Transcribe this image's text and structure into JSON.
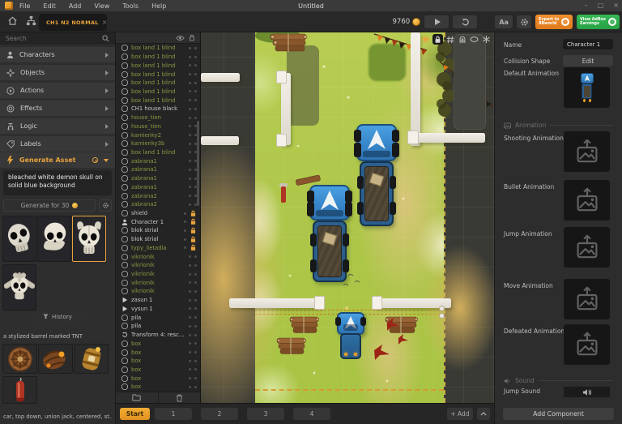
{
  "window": {
    "title": "Untitled",
    "menus": [
      "File",
      "Edit",
      "Add",
      "View",
      "Tools",
      "Help"
    ],
    "controls": {
      "min": "–",
      "max": "□",
      "close": "×"
    }
  },
  "toolbar": {
    "tab": "CH1 N2 NORMAL",
    "tab_close": "×",
    "coins": "9760",
    "font_button": "Aa",
    "export_line1": "Export to",
    "export_line2": "8Bworld",
    "earnings_line1": "View AdBox",
    "earnings_line2": "Earnings"
  },
  "sidebar": {
    "search_placeholder": "Search",
    "sections": [
      {
        "label": "Characters"
      },
      {
        "label": "Objects"
      },
      {
        "label": "Actions"
      },
      {
        "label": "Effects"
      },
      {
        "label": "Logic"
      },
      {
        "label": "Labels"
      }
    ],
    "generate_section": "Generate Asset",
    "prompt_text": "bleached white demon skull on solid blue background",
    "generate_button": "Generate for 30",
    "history_button": "History",
    "tnt_prompt": "a stylized barrel marked TNT",
    "car_prompt": "car, top down, union jack, centered, st..."
  },
  "layers": {
    "items": [
      {
        "name": "box land 1 blind",
        "cls": "g",
        "icon": "obj"
      },
      {
        "name": "box land 1 blind",
        "cls": "g",
        "icon": "obj"
      },
      {
        "name": "box land 1 blind",
        "cls": "g",
        "icon": "obj"
      },
      {
        "name": "box land 1 blind",
        "cls": "g",
        "icon": "obj"
      },
      {
        "name": "box land 1 blind",
        "cls": "g",
        "icon": "obj"
      },
      {
        "name": "box land 1 blind",
        "cls": "g",
        "icon": "obj"
      },
      {
        "name": "box land 1 blind",
        "cls": "g",
        "icon": "obj"
      },
      {
        "name": "CH1 house black",
        "cls": "w",
        "icon": "obj"
      },
      {
        "name": "house_tien",
        "cls": "g",
        "icon": "obj"
      },
      {
        "name": "house_tien",
        "cls": "g",
        "icon": "obj"
      },
      {
        "name": "kamienky2",
        "cls": "g",
        "icon": "obj"
      },
      {
        "name": "kamienky3b",
        "cls": "g",
        "icon": "obj"
      },
      {
        "name": "box land 1 blind",
        "cls": "g",
        "icon": "obj"
      },
      {
        "name": "zabrana1",
        "cls": "g",
        "icon": "obj"
      },
      {
        "name": "zabrana1",
        "cls": "g",
        "icon": "obj"
      },
      {
        "name": "zabrana1",
        "cls": "g",
        "icon": "obj"
      },
      {
        "name": "zabrana1",
        "cls": "g",
        "icon": "obj"
      },
      {
        "name": "zabrana2",
        "cls": "g",
        "icon": "obj"
      },
      {
        "name": "zabrana2",
        "cls": "g",
        "icon": "obj"
      },
      {
        "name": "shield",
        "cls": "w",
        "icon": "obj",
        "lock": true
      },
      {
        "name": "Character 1",
        "cls": "w",
        "icon": "person",
        "lock": true
      },
      {
        "name": "blok strial",
        "cls": "w",
        "icon": "obj",
        "lock": true
      },
      {
        "name": "blok strial",
        "cls": "w",
        "icon": "obj",
        "lock": true
      },
      {
        "name": "typy_lietadla",
        "cls": "g",
        "icon": "obj",
        "lock": true
      },
      {
        "name": "vikrionik",
        "cls": "g",
        "icon": "obj"
      },
      {
        "name": "vikrionik",
        "cls": "g",
        "icon": "obj"
      },
      {
        "name": "vikrionik",
        "cls": "g",
        "icon": "obj"
      },
      {
        "name": "vikrionik",
        "cls": "g",
        "icon": "obj"
      },
      {
        "name": "vikrionik",
        "cls": "g",
        "icon": "obj"
      },
      {
        "name": "zasun 1",
        "cls": "w",
        "icon": "tri"
      },
      {
        "name": "vysun 1",
        "cls": "w",
        "icon": "tri"
      },
      {
        "name": "pila",
        "cls": "w",
        "icon": "obj"
      },
      {
        "name": "pila",
        "cls": "w",
        "icon": "obj"
      },
      {
        "name": "Transform 4: rescue...",
        "cls": "w",
        "icon": "ref"
      },
      {
        "name": "box",
        "cls": "g",
        "icon": "obj"
      },
      {
        "name": "box",
        "cls": "g",
        "icon": "obj"
      },
      {
        "name": "box",
        "cls": "g",
        "icon": "obj"
      },
      {
        "name": "box",
        "cls": "g",
        "icon": "obj"
      },
      {
        "name": "box",
        "cls": "g",
        "icon": "obj"
      },
      {
        "name": "box",
        "cls": "g",
        "icon": "obj"
      }
    ]
  },
  "inspector": {
    "name_label": "Name",
    "name_value": "Character 1",
    "collision_label": "Collision Shape",
    "edit_button": "Edit",
    "default_anim_label": "Default Animation",
    "animation_section": "Animation",
    "animations": [
      "Shooting Animation",
      "Bullet Animation",
      "Jump Animation",
      "Move Animation",
      "Defeated Animation"
    ],
    "sound_section": "Sound",
    "jump_sound_label": "Jump Sound",
    "add_component_button": "Add Component"
  },
  "bottom_bar": {
    "start": "Start",
    "levels": [
      "1",
      "2",
      "3",
      "4"
    ],
    "add_button": "+ Add"
  },
  "colors": {
    "accent_orange": "#e8a33d",
    "export_orange": "#e8821e",
    "earnings_green": "#2fae4e",
    "layer_green": "#8a9942",
    "grass": "#aec74a",
    "tractor_blue": "#3a8fd0",
    "coin_gold": "#e9a83a"
  }
}
